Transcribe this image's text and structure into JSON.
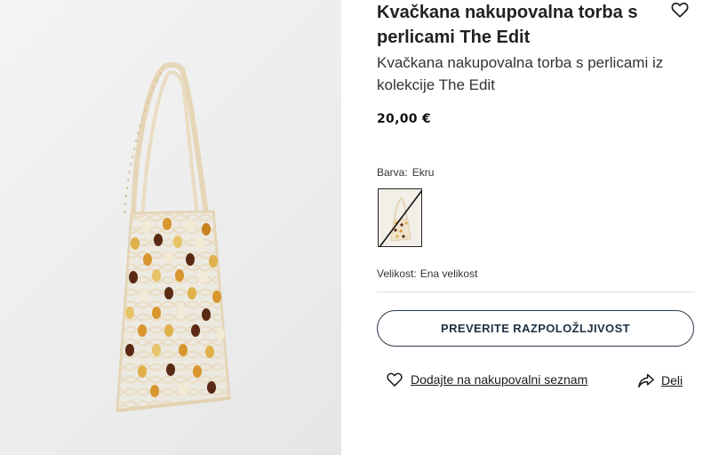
{
  "product": {
    "title": "Kvačkana nakupovalna torba s perlicami The Edit",
    "subtitle": "Kvačkana nakupovalna torba s perlicami iz kolekcije The Edit",
    "price": "20,00 €"
  },
  "color": {
    "label": "Barva:",
    "value": "Ekru"
  },
  "size": {
    "label": "Velikost:",
    "value": "Ena velikost"
  },
  "actions": {
    "check_availability": "PREVERITE RAZPOLOŽLJIVOST",
    "add_to_wishlist": "Dodajte na nakupovalni seznam",
    "share": "Deli"
  },
  "icons": {
    "favorite": "heart-outline-icon",
    "wishlist": "heart-outline-icon",
    "share": "share-arrow-icon"
  },
  "colors": {
    "accent": "#1f3142",
    "bead_amber": "#d9962e",
    "bead_brown": "#5a2a14",
    "bead_cream": "#f3ead6",
    "bag_cord": "#e9dcc4"
  }
}
